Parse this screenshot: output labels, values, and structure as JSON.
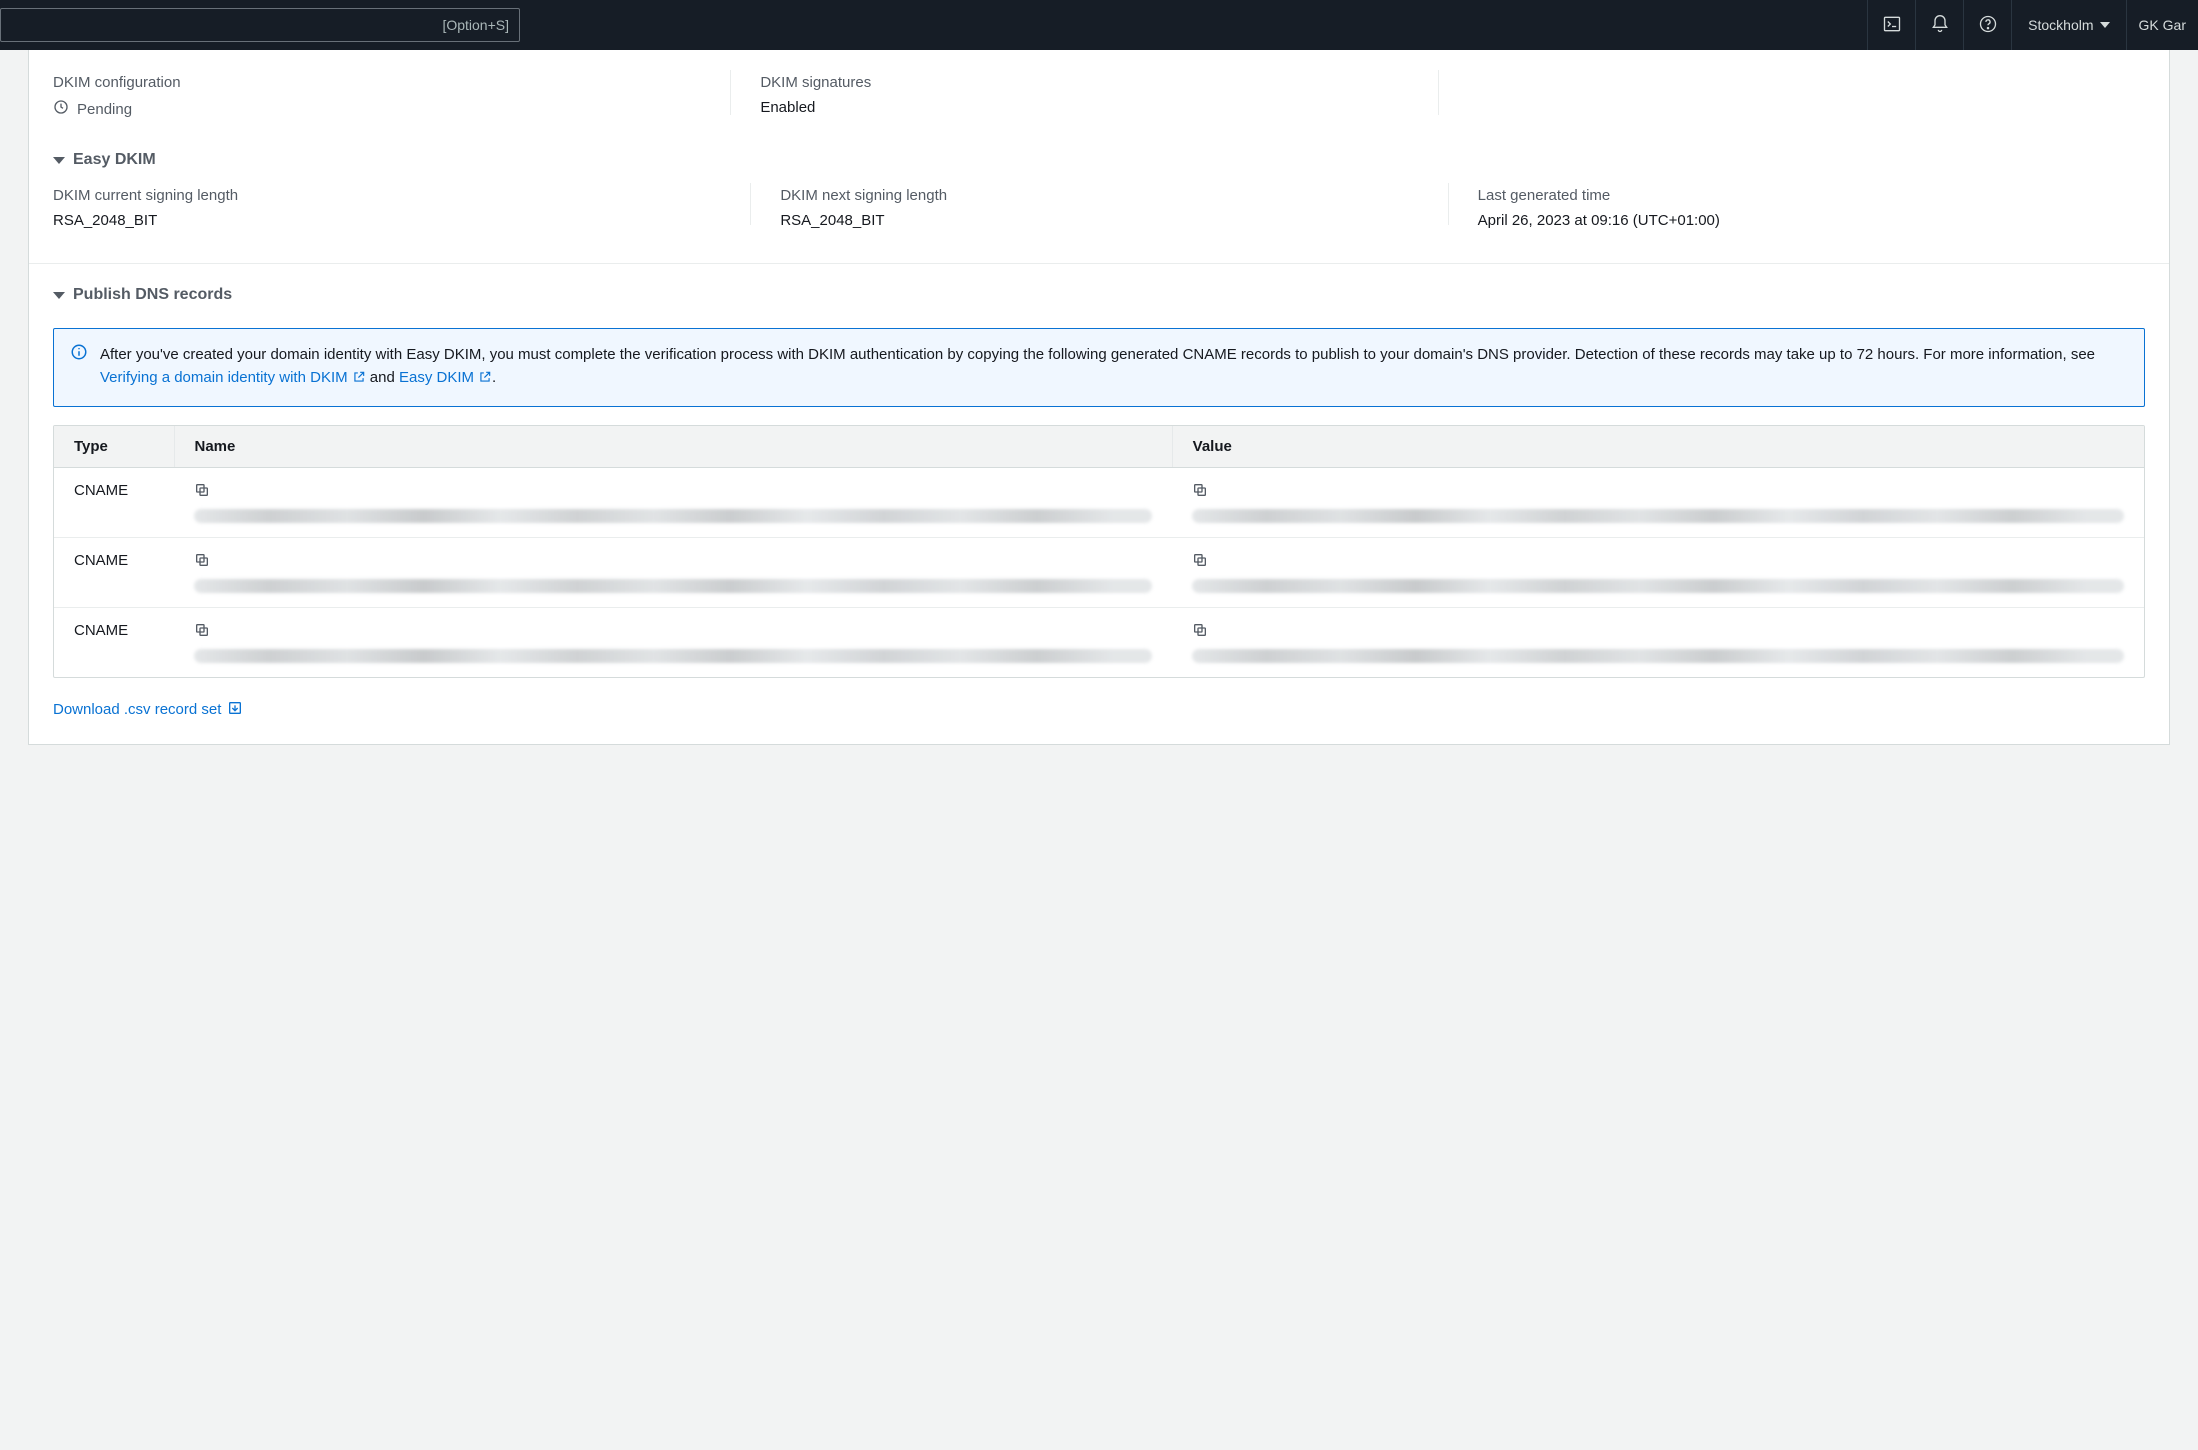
{
  "topnav": {
    "search_hint": "[Option+S]",
    "region": "Stockholm",
    "user": "GK Gar"
  },
  "dkim": {
    "config_label": "DKIM configuration",
    "config_value": "Pending",
    "signatures_label": "DKIM signatures",
    "signatures_value": "Enabled"
  },
  "easy_dkim": {
    "title": "Easy DKIM",
    "current_length_label": "DKIM current signing length",
    "current_length_value": "RSA_2048_BIT",
    "next_length_label": "DKIM next signing length",
    "next_length_value": "RSA_2048_BIT",
    "last_gen_label": "Last generated time",
    "last_gen_value": "April 26, 2023 at 09:16 (UTC+01:00)"
  },
  "dns": {
    "title": "Publish DNS records",
    "info_text_1": "After you've created your domain identity with Easy DKIM, you must complete the verification process with DKIM authentication by copying the following generated CNAME records to publish to your domain's DNS provider. Detection of these records may take up to 72 hours. For more information, see ",
    "info_link_1": "Verifying a domain identity with DKIM",
    "info_text_2": " and ",
    "info_link_2": "Easy DKIM",
    "info_text_3": ".",
    "columns": {
      "type": "Type",
      "name": "Name",
      "value": "Value"
    },
    "rows": [
      {
        "type": "CNAME"
      },
      {
        "type": "CNAME"
      },
      {
        "type": "CNAME"
      }
    ],
    "download_label": "Download .csv record set"
  }
}
